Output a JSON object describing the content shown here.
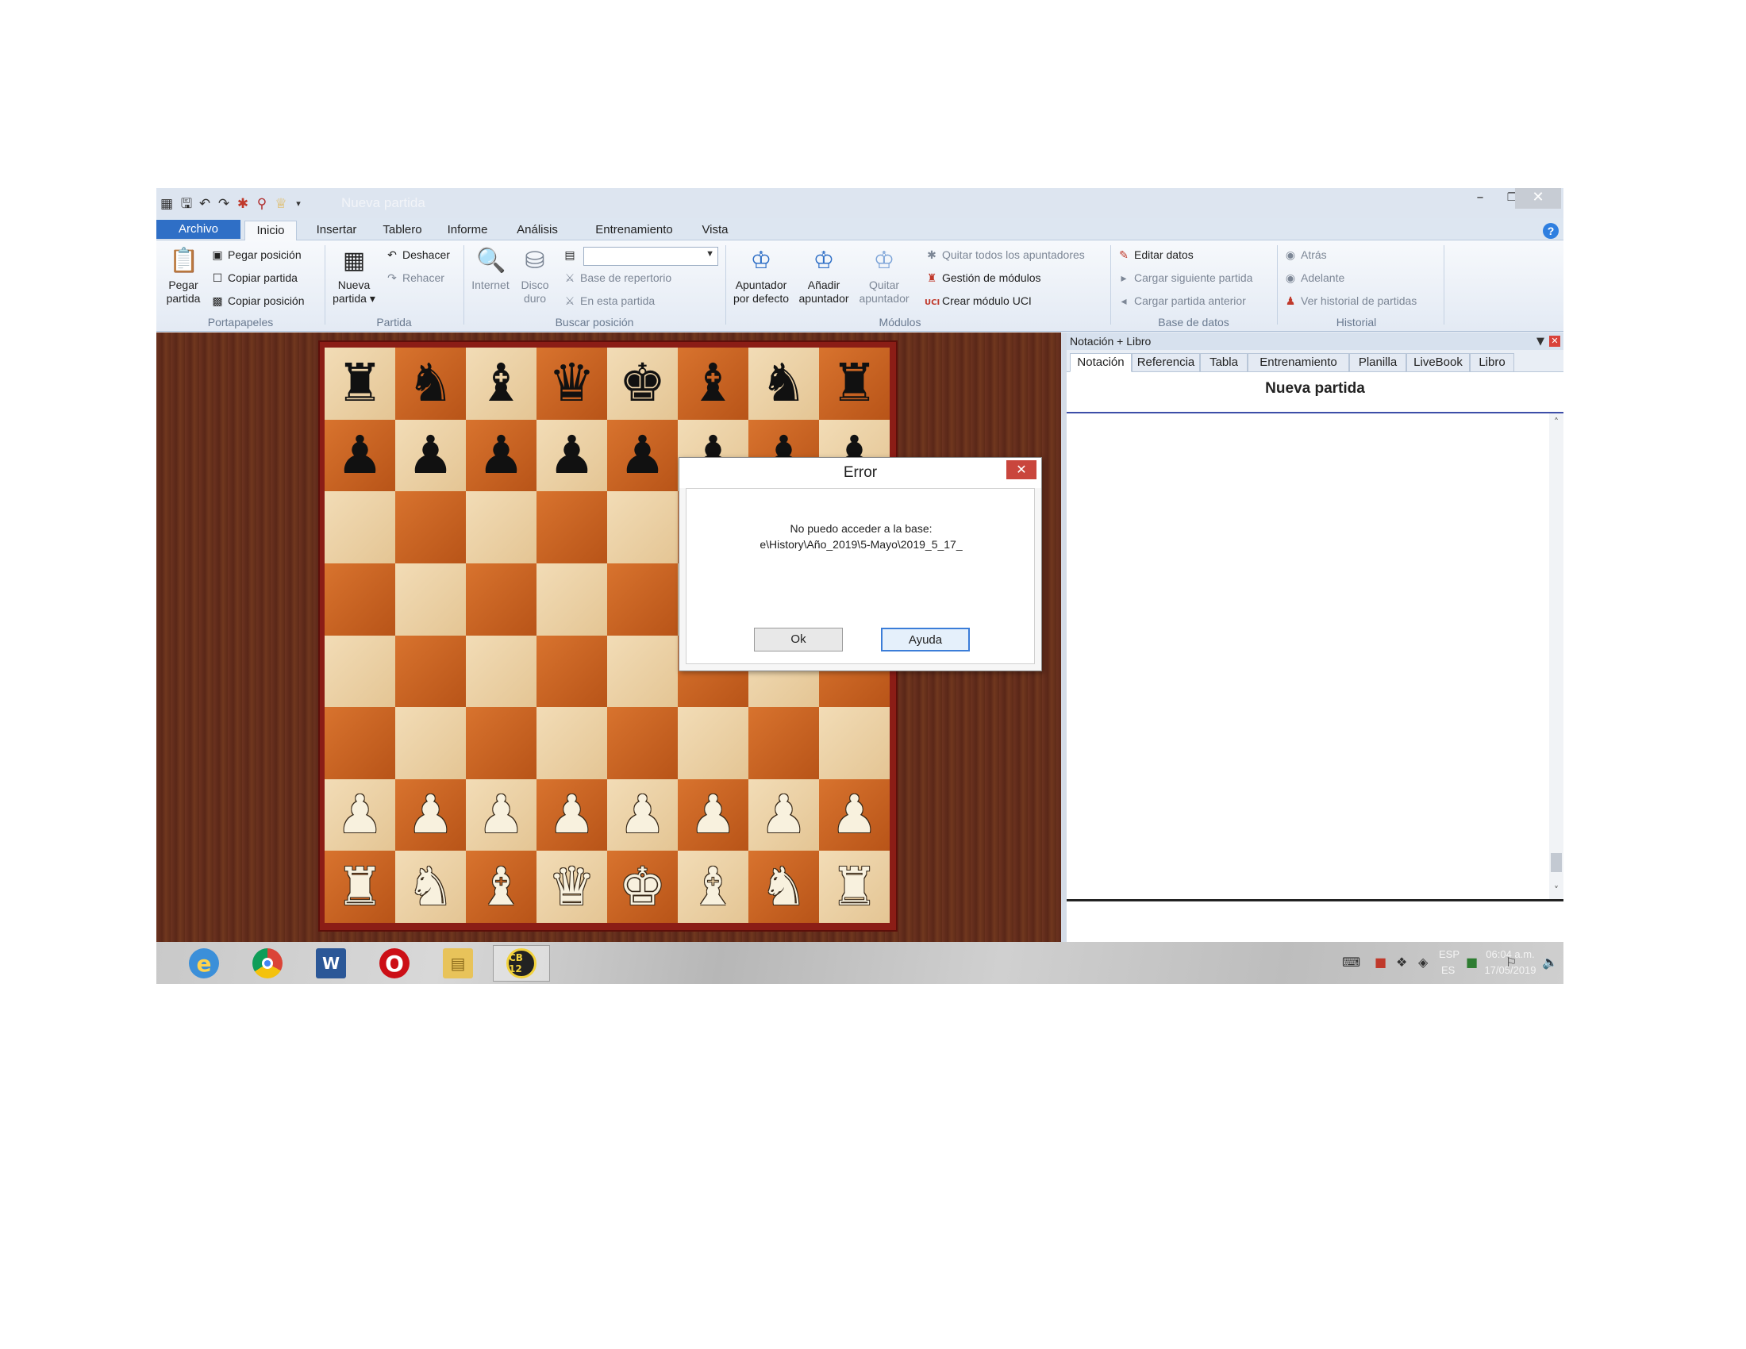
{
  "window": {
    "title": "Nueva partida",
    "minimize_glyph": "–",
    "restore_glyph": "❐",
    "close_glyph": "✕"
  },
  "quick_access": [
    "board-icon",
    "save-icon",
    "undo-icon",
    "redo-icon",
    "engine-icon",
    "pin-icon",
    "trophy-icon",
    "dropdown-icon"
  ],
  "ribbon_tabs": [
    "Archivo",
    "Inicio",
    "Insertar",
    "Tablero",
    "Informe",
    "Análisis",
    "Entrenamiento",
    "Vista"
  ],
  "active_tab": "Inicio",
  "ribbon": {
    "portapapeles": {
      "group_label": "Portapapeles",
      "pegar_partida": [
        "Pegar",
        "partida"
      ],
      "pegar_posicion": "Pegar posición",
      "copiar_partida": "Copiar partida",
      "copiar_posicion": "Copiar posición"
    },
    "partida": {
      "group_label": "Partida",
      "nueva_partida": [
        "Nueva",
        "partida ▾"
      ],
      "deshacer": "Deshacer",
      "rehacer": "Rehacer"
    },
    "buscar": {
      "group_label": "Buscar posición",
      "internet": "Internet",
      "disco_duro": [
        "Disco",
        "duro"
      ],
      "base_repertorio": "Base de repertorio",
      "en_esta_partida": "En esta partida"
    },
    "modulos": {
      "group_label": "Módulos",
      "apuntador_defecto": [
        "Apuntador",
        "por defecto"
      ],
      "anadir_apuntador": [
        "Añadir",
        "apuntador"
      ],
      "quitar_apuntador": [
        "Quitar",
        "apuntador"
      ],
      "quitar_todos": "Quitar todos los apuntadores",
      "gestion_modulos": "Gestión de módulos",
      "crear_uci": "Crear módulo UCI"
    },
    "base_datos": {
      "group_label": "Base de datos",
      "editar_datos": "Editar datos",
      "cargar_siguiente": "Cargar siguiente partida",
      "cargar_anterior": "Cargar partida anterior"
    },
    "historial": {
      "group_label": "Historial",
      "atras": "Atrás",
      "adelante": "Adelante",
      "ver_historial": "Ver historial de partidas"
    }
  },
  "board": {
    "ranks": [
      [
        "♜",
        "♞",
        "♝",
        "♛",
        "♚",
        "♝",
        "♞",
        "♜"
      ],
      [
        "♟",
        "♟",
        "♟",
        "♟",
        "♟",
        "♟",
        "♟",
        "♟"
      ],
      [
        "",
        "",
        "",
        "",
        "",
        "",
        "",
        ""
      ],
      [
        "",
        "",
        "",
        "",
        "",
        "",
        "",
        ""
      ],
      [
        "",
        "",
        "",
        "",
        "",
        "",
        "",
        ""
      ],
      [
        "",
        "",
        "",
        "",
        "",
        "",
        "",
        ""
      ],
      [
        "♟",
        "♟",
        "♟",
        "♟",
        "♟",
        "♟",
        "♟",
        "♟"
      ],
      [
        "♜",
        "♞",
        "♝",
        "♛",
        "♚",
        "♝",
        "♞",
        "♜"
      ]
    ],
    "colors": [
      "b",
      "b",
      "",
      "",
      "",
      "",
      "w",
      "w"
    ]
  },
  "panel": {
    "title": "Notación + Libro",
    "tabs": [
      "Notación",
      "Referencia",
      "Tabla",
      "Entrenamiento",
      "Planilla",
      "LiveBook",
      "Libro"
    ],
    "active_tab": "Notación",
    "game_title": "Nueva partida"
  },
  "dialog": {
    "title": "Error",
    "message_line1": "No puedo acceder a la base:",
    "message_line2": "e\\History\\Año_2019\\5-Mayo\\2019_5_17_",
    "ok": "Ok",
    "help": "Ayuda"
  },
  "taskbar": {
    "apps": [
      "internet-explorer-icon",
      "chrome-icon",
      "word-icon",
      "opera-icon",
      "file-explorer-icon",
      "chessbase-12-icon"
    ],
    "cb_label": "CB 12",
    "lang_top": "ESP",
    "lang_bottom": "ES",
    "time": "06:04 a.m.",
    "date": "17/05/2019"
  }
}
